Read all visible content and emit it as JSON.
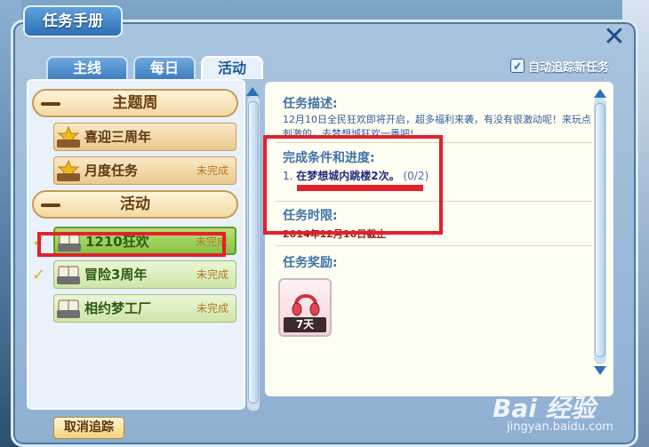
{
  "window": {
    "title": "任务手册",
    "close_symbol": "✕"
  },
  "tabs": [
    {
      "label": "主线",
      "active": false
    },
    {
      "label": "每日",
      "active": false
    },
    {
      "label": "活动",
      "active": true
    }
  ],
  "auto_track": {
    "label": "自动追踪新任务",
    "checked": true,
    "check_glyph": "✓"
  },
  "task_list": {
    "categories": [
      {
        "label": "主题周"
      },
      {
        "label": "活动"
      }
    ],
    "items": [
      {
        "icon_text": "主题周",
        "name": "喜迎三周年",
        "status": "",
        "checked": false
      },
      {
        "icon_text": "主题周",
        "name": "月度任务",
        "status": "未完成",
        "checked": false
      },
      {
        "icon_text": "活动",
        "name": "1210狂欢",
        "status": "未完成",
        "checked": true,
        "selected": true
      },
      {
        "icon_text": "活动",
        "name": "冒险3周年",
        "status": "未完成",
        "checked": true
      },
      {
        "icon_text": "活动",
        "name": "相约梦工厂",
        "status": "未完成",
        "checked": false
      }
    ],
    "check_glyph": "✓"
  },
  "detail": {
    "desc_title": "任务描述:",
    "desc_text": "12月10日全民狂欢即将开启，超多福利来袭，有没有很激动呢！来玩点刺激的，去梦想城狂欢一番吧!",
    "cond_title": "完成条件和进度:",
    "cond_prefix": "1.",
    "cond_text": "在梦想城内跳楼2次。",
    "cond_progress": "(0/2)",
    "limit_title": "任务时限:",
    "limit_text": "2014年12月10日截止",
    "reward_title": "任务奖励:",
    "reward_days": "7天"
  },
  "buttons": {
    "cancel_track": "取消追踪"
  },
  "watermark": {
    "brand": "Bai  经验",
    "url": "jingyan.baidu.com"
  },
  "colors": {
    "highlight": "#e4202a",
    "accent": "#2f6fb6"
  }
}
